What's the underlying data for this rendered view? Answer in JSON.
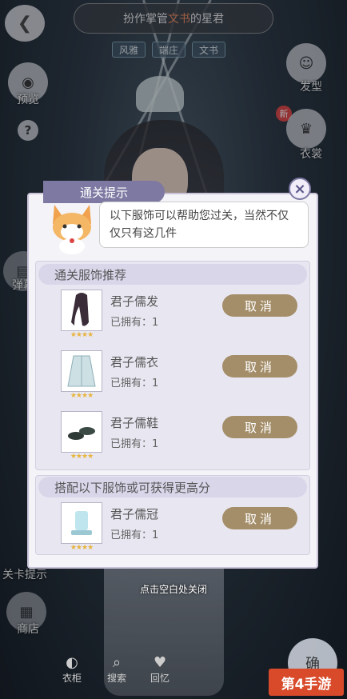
{
  "header": {
    "title_prefix": "扮作掌管",
    "title_highlight": "文书",
    "title_suffix": "的星君"
  },
  "tags": [
    "风雅",
    "端庄",
    "文书"
  ],
  "left_sidebar": {
    "preview_label": "预览",
    "help": "?",
    "bullet_label": "弹幕",
    "challenge_hint_label": "关卡提示",
    "shop_label": "商店"
  },
  "right_sidebar": {
    "hair_label": "发型",
    "clothes_label": "衣裳",
    "new_badge": "新"
  },
  "dialog": {
    "title": "通关提示",
    "close": "×",
    "message": "以下服饰可以帮助您过关，当然不仅仅只有这几件",
    "recommend_header": "通关服饰推荐",
    "match_header": "搭配以下服饰或可获得更高分",
    "recommend_items": [
      {
        "name": "君子儒发",
        "owned": "已拥有：1",
        "stars": "★★★★",
        "button": "取消"
      },
      {
        "name": "君子儒衣",
        "owned": "已拥有：1",
        "stars": "★★★★",
        "button": "取消"
      },
      {
        "name": "君子儒鞋",
        "owned": "已拥有：1",
        "stars": "★★★★",
        "button": "取消"
      }
    ],
    "match_items": [
      {
        "name": "君子儒冠",
        "owned": "已拥有：1",
        "stars": "★★★★",
        "button": "取消"
      }
    ]
  },
  "close_hint": "点击空白处关闭",
  "bottom_nav": {
    "item1": "衣柜",
    "item2": "搜索",
    "item3": "回忆",
    "confirm": "确"
  },
  "watermark": "第4手游",
  "colors": {
    "dialog_accent": "#7d79a2",
    "cancel_button": "#a48e6a",
    "stars": "#e7b53d"
  }
}
